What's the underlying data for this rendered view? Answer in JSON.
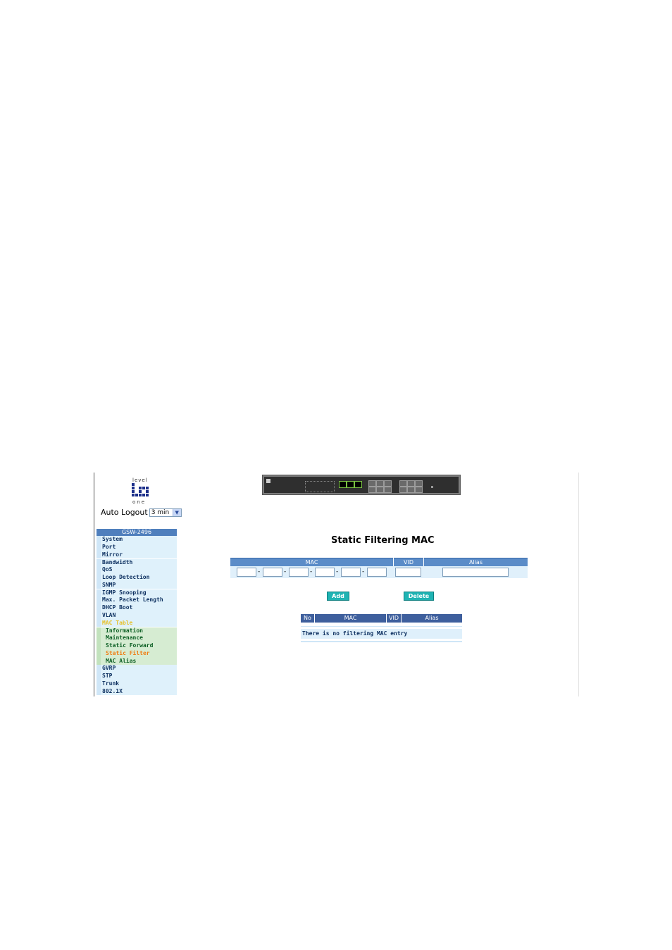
{
  "logo": {
    "top_text": "level",
    "bottom_text": "one"
  },
  "auto_logout": {
    "label": "Auto Logout",
    "value": "3 min"
  },
  "sidebar": {
    "header": "GSW-2496",
    "items": [
      {
        "label": "System"
      },
      {
        "label": "Port"
      },
      {
        "label": "Mirror"
      },
      {
        "label": "Bandwidth"
      },
      {
        "label": "QoS"
      },
      {
        "label": "Loop Detection"
      },
      {
        "label": "SNMP"
      },
      {
        "label": "IGMP Snooping"
      },
      {
        "label": "Max. Packet Length"
      },
      {
        "label": "DHCP Boot"
      },
      {
        "label": "VLAN"
      },
      {
        "label": "MAC Table"
      }
    ],
    "subitems": [
      {
        "label": "Information"
      },
      {
        "label": "Maintenance"
      },
      {
        "label": "Static Forward"
      },
      {
        "label": "Static Filter"
      },
      {
        "label": "MAC Alias"
      }
    ],
    "items_after": [
      {
        "label": "GVRP"
      },
      {
        "label": "STP"
      },
      {
        "label": "Trunk"
      },
      {
        "label": "802.1X"
      }
    ]
  },
  "main": {
    "title": "Static Filtering MAC",
    "entry_table": {
      "col_mac": "MAC",
      "col_vid": "VID",
      "col_alias": "Alias",
      "separator": "-"
    },
    "buttons": {
      "add": "Add",
      "delete": "Delete"
    },
    "list_table": {
      "col_no": "No",
      "col_mac": "MAC",
      "col_vid": "VID",
      "col_alias": "Alias",
      "empty_message": "There is no filtering MAC entry"
    }
  },
  "colors": {
    "header_blue": "#5b8cc8",
    "button_teal": "#1fb3b3",
    "active_menu": "#e6c12a",
    "active_sub": "#f07c12"
  }
}
